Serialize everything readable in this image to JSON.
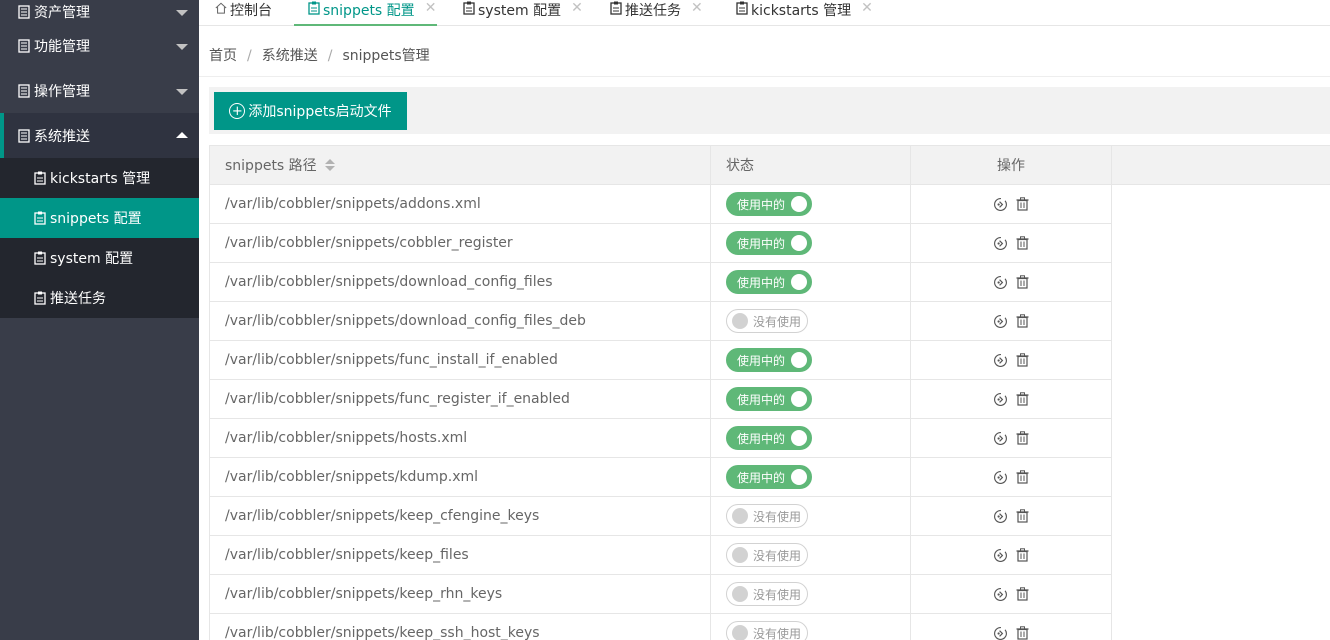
{
  "sidebar": {
    "menus": [
      {
        "label": "资产管理",
        "state": "collapsed"
      },
      {
        "label": "功能管理",
        "state": "collapsed"
      },
      {
        "label": "操作管理",
        "state": "collapsed"
      },
      {
        "label": "系统推送",
        "state": "expanded"
      }
    ],
    "submenu": [
      {
        "label": "kickstarts 管理"
      },
      {
        "label": "snippets 配置",
        "active": true
      },
      {
        "label": "system 配置"
      },
      {
        "label": "推送任务"
      }
    ]
  },
  "tabs": [
    {
      "label": "控制台",
      "icon": "home-icon",
      "closable": false
    },
    {
      "label": "snippets 配置",
      "icon": "doc-icon",
      "closable": true,
      "active": true
    },
    {
      "label": "system 配置",
      "icon": "doc-icon",
      "closable": true
    },
    {
      "label": "推送任务",
      "icon": "doc-icon",
      "closable": true
    },
    {
      "label": "kickstarts 管理",
      "icon": "doc-icon",
      "closable": true
    }
  ],
  "close_glyph": "✕",
  "breadcrumb": [
    "首页",
    "系统推送",
    "snippets管理"
  ],
  "breadcrumb_sep": "/",
  "toolbar": {
    "add_label": "添加snippets启动文件"
  },
  "table": {
    "headers": {
      "path": "snippets 路径",
      "status": "状态",
      "ops": "操作"
    },
    "on_label": "使用中的",
    "off_label": "没有使用",
    "rows": [
      {
        "path": "/var/lib/cobbler/snippets/addons.xml",
        "enabled": true
      },
      {
        "path": "/var/lib/cobbler/snippets/cobbler_register",
        "enabled": true
      },
      {
        "path": "/var/lib/cobbler/snippets/download_config_files",
        "enabled": true
      },
      {
        "path": "/var/lib/cobbler/snippets/download_config_files_deb",
        "enabled": false
      },
      {
        "path": "/var/lib/cobbler/snippets/func_install_if_enabled",
        "enabled": true
      },
      {
        "path": "/var/lib/cobbler/snippets/func_register_if_enabled",
        "enabled": true
      },
      {
        "path": "/var/lib/cobbler/snippets/hosts.xml",
        "enabled": true
      },
      {
        "path": "/var/lib/cobbler/snippets/kdump.xml",
        "enabled": true
      },
      {
        "path": "/var/lib/cobbler/snippets/keep_cfengine_keys",
        "enabled": false
      },
      {
        "path": "/var/lib/cobbler/snippets/keep_files",
        "enabled": false
      },
      {
        "path": "/var/lib/cobbler/snippets/keep_rhn_keys",
        "enabled": false
      },
      {
        "path": "/var/lib/cobbler/snippets/keep_ssh_host_keys",
        "enabled": false
      }
    ]
  },
  "colors": {
    "accent": "#009688",
    "switch_on": "#5fb878",
    "sidebar_bg": "#393d49",
    "submenu_bg": "#23262e"
  }
}
